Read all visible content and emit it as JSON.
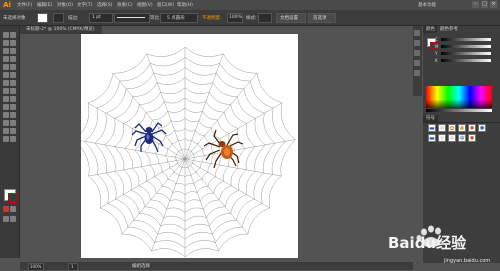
{
  "app": {
    "logo": "Ai"
  },
  "menubar": {
    "items": [
      "文件(F)",
      "编辑(E)",
      "对象(O)",
      "文字(T)",
      "选择(S)",
      "效果(C)",
      "视图(V)",
      "窗口(W)",
      "帮助(H)"
    ],
    "workspace": "基本功能"
  },
  "control_bar": {
    "selection_label": "未选择对象",
    "stroke_label": "描边:",
    "stroke_value": "1 pt",
    "profile_label": "等比",
    "brush_value": "5 点圆形",
    "opacity_label": "不透明度:",
    "opacity_value": "100%",
    "style_label": "样式:",
    "doc_setup_button": "文档设置",
    "prefs_button": "首选项"
  },
  "document": {
    "tab_title": "未标题-2* @ 100% (CMYK/预览)"
  },
  "statusbar": {
    "zoom": "100%",
    "page": "1",
    "tool": "编组选择"
  },
  "panels": {
    "color_tabs": [
      "颜色",
      "颜色参考"
    ],
    "channels": [
      "C",
      "M",
      "Y",
      "K"
    ],
    "symbols_tab": "符号"
  },
  "watermark": {
    "brand": "Baidu经验",
    "url": "jingyan.baidu.com"
  },
  "colors": {
    "accent": "#ff9a00",
    "spider_blue": "#1e2a7a",
    "spider_orange": "#c85a12"
  }
}
